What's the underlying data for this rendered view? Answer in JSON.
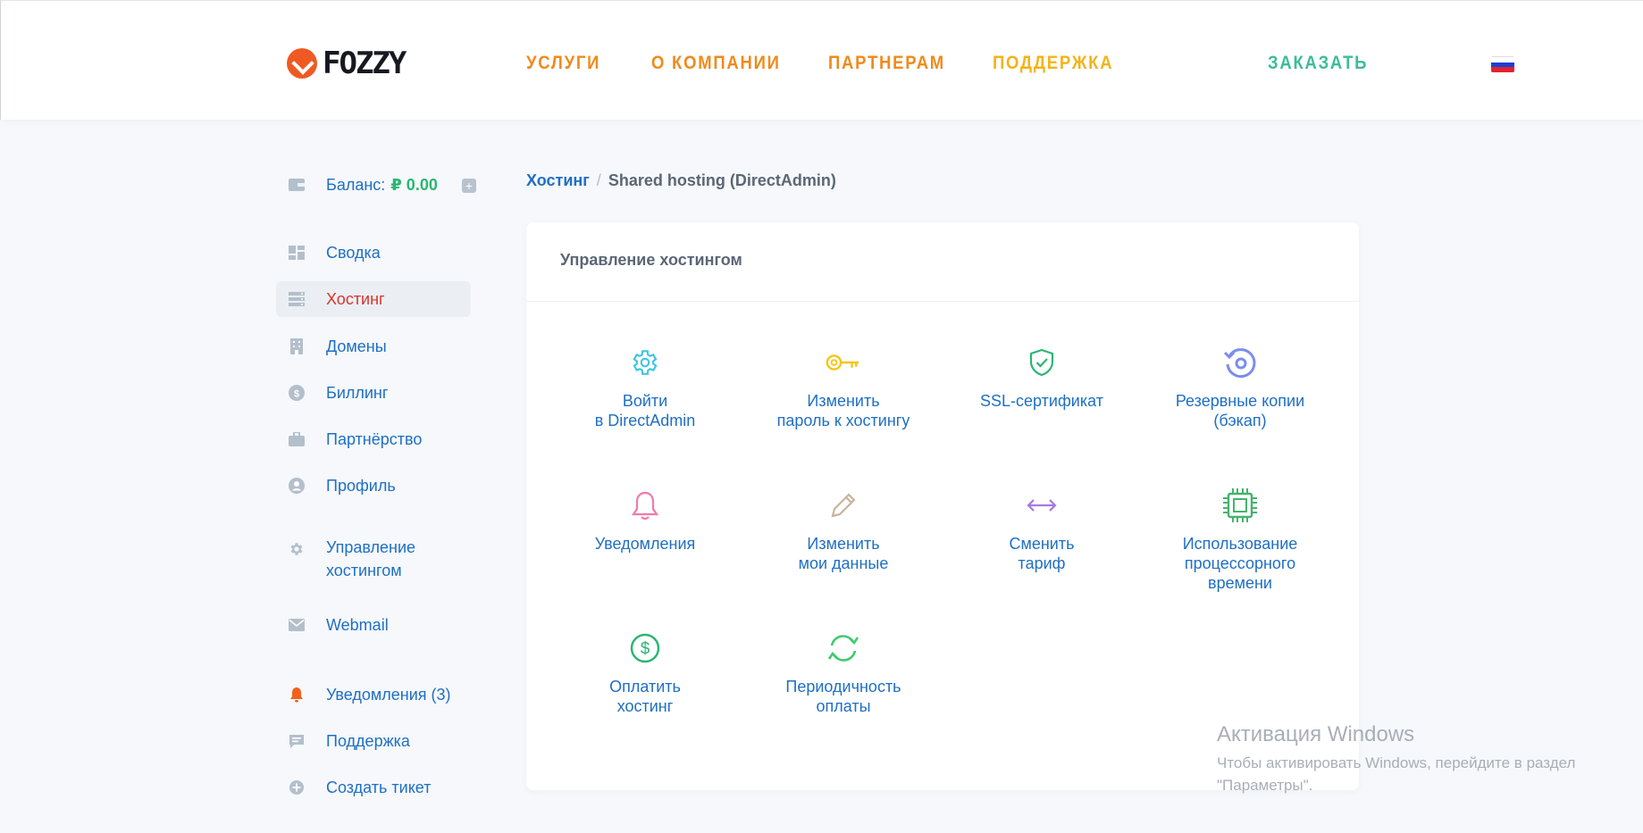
{
  "header": {
    "logo_text": "FOZZY",
    "nav": [
      "Услуги",
      "О компании",
      "Партнерам",
      "Поддержка"
    ],
    "order_label": "Заказать",
    "flag": "russia-flag"
  },
  "sidebar": {
    "balance_label": "Баланс:",
    "balance_value": "₽ 0.00",
    "items": [
      {
        "label": "Сводка",
        "icon": "dashboard-icon"
      },
      {
        "label": "Хостинг",
        "icon": "server-icon",
        "active": true
      },
      {
        "label": "Домены",
        "icon": "building-icon"
      },
      {
        "label": "Биллинг",
        "icon": "coin-icon"
      },
      {
        "label": "Партнёрство",
        "icon": "briefcase-icon"
      },
      {
        "label": "Профиль",
        "icon": "user-icon"
      },
      {
        "label": "Управление хостингом",
        "icon": "gear-icon"
      },
      {
        "label": "Webmail",
        "icon": "mail-icon"
      },
      {
        "label": "Уведомления (3)",
        "icon": "bell-icon"
      },
      {
        "label": "Поддержка",
        "icon": "chat-icon"
      },
      {
        "label": "Создать тикет",
        "icon": "plus-circle-icon"
      }
    ]
  },
  "breadcrumb": {
    "link": "Хостинг",
    "separator": "/",
    "current": "Shared hosting (DirectAdmin)"
  },
  "card": {
    "title": "Управление хостингом",
    "tiles": [
      {
        "label": "Войти\nв DirectAdmin",
        "icon": "gear-icon",
        "color": "#3ec6e0"
      },
      {
        "label": "Изменить\nпароль к хостингу",
        "icon": "key-icon",
        "color": "#f5c518"
      },
      {
        "label": "SSL-сертификат",
        "icon": "shield-check-icon",
        "color": "#2bb673"
      },
      {
        "label": "Резервные копии\n(бэкап)",
        "icon": "backup-icon",
        "color": "#7b8cf0"
      },
      {
        "label": "Уведомления",
        "icon": "bell-icon",
        "color": "#f07aa8"
      },
      {
        "label": "Изменить\nмои данные",
        "icon": "pencil-icon",
        "color": "#c8b49a"
      },
      {
        "label": "Сменить\nтариф",
        "icon": "arrows-horizontal-icon",
        "color": "#a678e8"
      },
      {
        "label": "Использование\nпроцессорного\nвремени",
        "icon": "cpu-icon",
        "color": "#45b36b"
      },
      {
        "label": "Оплатить\nхостинг",
        "icon": "dollar-icon",
        "color": "#2bb673"
      },
      {
        "label": "Периодичность\nоплаты",
        "icon": "refresh-icon",
        "color": "#3ecb6f"
      }
    ]
  },
  "watermark": {
    "title": "Активация Windows",
    "text": "Чтобы активировать Windows, перейдите в раздел \"Параметры\"."
  }
}
